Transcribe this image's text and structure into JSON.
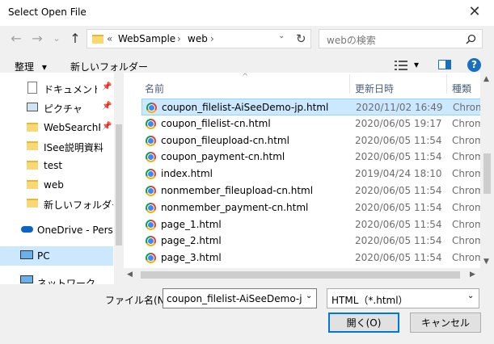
{
  "window": {
    "title": "Select Open File",
    "close_glyph": "✕"
  },
  "nav": {
    "back": "←",
    "forward": "→",
    "dropdown": "⌄",
    "up": "↑"
  },
  "address": {
    "prefix": "«",
    "crumbs": [
      "WebSample",
      "web"
    ],
    "sep": "›",
    "refresh": "↻"
  },
  "search": {
    "placeholder": "webの検索",
    "icon": "search-icon"
  },
  "toolbar": {
    "organize": "整理",
    "organize_arrow": "▾",
    "new_folder": "新しいフォルダー",
    "view_arrow": "▾",
    "help": "?"
  },
  "sidebar": {
    "items": [
      {
        "label": "ドキュメント",
        "icon": "document-icon",
        "pinned": true
      },
      {
        "label": "ピクチャ",
        "icon": "picture-icon",
        "pinned": true
      },
      {
        "label": "WebSearchPr",
        "icon": "folder-icon",
        "pinned": true
      },
      {
        "label": "ISee説明資料",
        "icon": "folder-icon"
      },
      {
        "label": "test",
        "icon": "folder-icon"
      },
      {
        "label": "web",
        "icon": "folder-icon"
      },
      {
        "label": "新しいフォルダー",
        "icon": "folder-icon"
      },
      {
        "label": "OneDrive - Persor",
        "icon": "cloud-icon"
      },
      {
        "label": "PC",
        "icon": "pc-icon"
      },
      {
        "label": "ネットワーク",
        "icon": "network-icon"
      }
    ]
  },
  "list": {
    "columns": [
      "名前",
      "更新日時",
      "種類"
    ],
    "sort_glyph": "^",
    "rows": [
      {
        "name": "coupon_filelist-AiSeeDemo-jp.html",
        "date": "2020/11/02 16:49",
        "type": "Chrom",
        "selected": true
      },
      {
        "name": "coupon_filelist-cn.html",
        "date": "2020/06/05 19:17",
        "type": "Chrom"
      },
      {
        "name": "coupon_fileupload-cn.html",
        "date": "2020/06/05 11:54",
        "type": "Chrom"
      },
      {
        "name": "coupon_payment-cn.html",
        "date": "2020/06/05 11:54",
        "type": "Chrom"
      },
      {
        "name": "index.html",
        "date": "2019/04/24 18:10",
        "type": "Chrom"
      },
      {
        "name": "nonmember_fileupload-cn.html",
        "date": "2020/06/05 11:54",
        "type": "Chrom"
      },
      {
        "name": "nonmember_payment-cn.html",
        "date": "2020/06/05 11:54",
        "type": "Chrom"
      },
      {
        "name": "page_1.html",
        "date": "2020/06/05 11:54",
        "type": "Chrom"
      },
      {
        "name": "page_2.html",
        "date": "2020/06/05 11:54",
        "type": "Chrom"
      },
      {
        "name": "page_3.html",
        "date": "2020/06/05 11:54",
        "type": "Chrom"
      }
    ]
  },
  "bottom": {
    "filename_label": "ファイル名(N):",
    "filename_value": "coupon_filelist-AiSeeDemo-jp.h",
    "filter_value": "HTML（*.html）",
    "open_label": "開く(O)",
    "cancel_label": "キャンセル"
  },
  "colors": {
    "accent": "#0078d7",
    "selection": "#cce8ff",
    "help_bg": "#1a6fc2"
  }
}
